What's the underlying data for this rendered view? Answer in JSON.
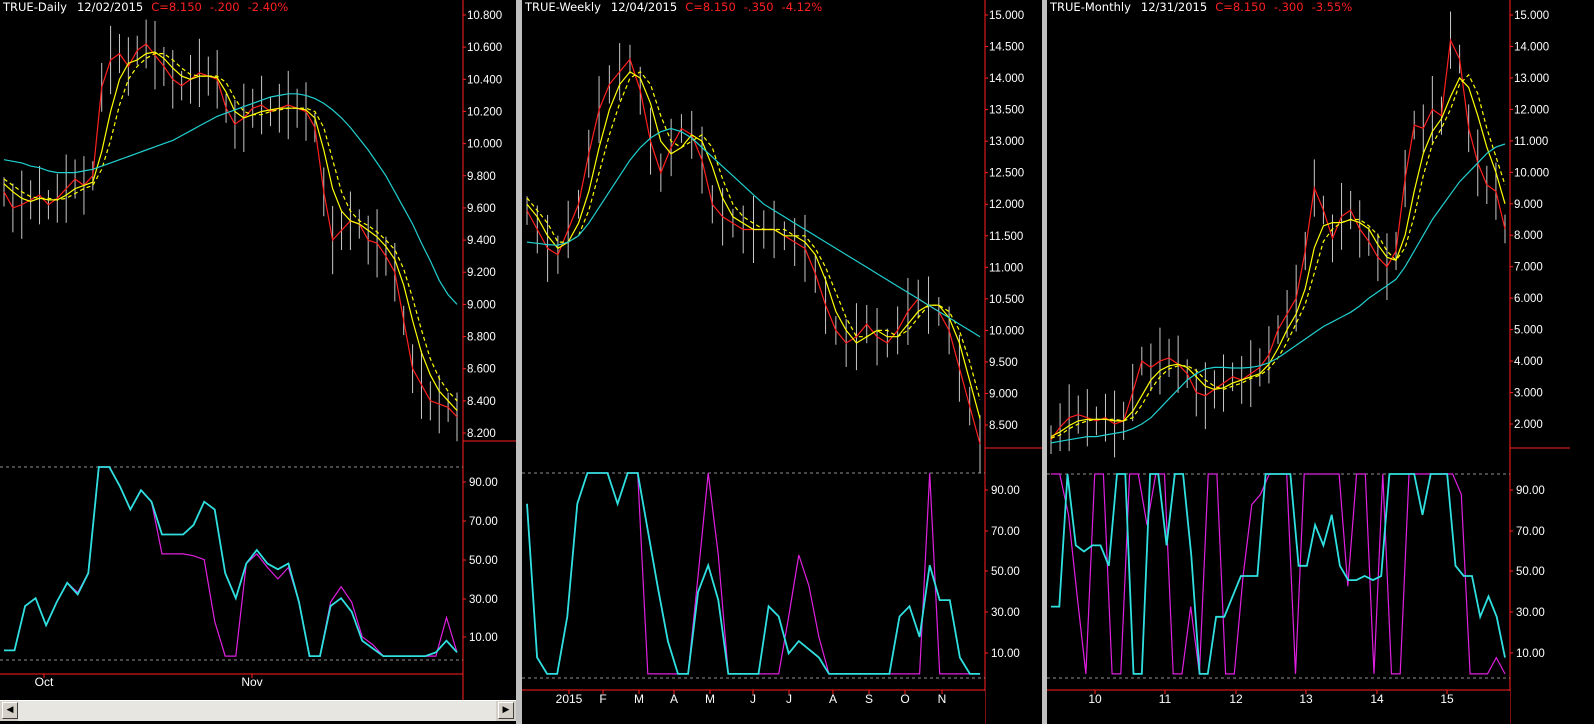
{
  "panels": [
    {
      "id": "daily",
      "symbol": "TRUE-Daily",
      "date": "12/02/2015",
      "close": "C=8.150",
      "change": "-.200",
      "pct": "-2.40%",
      "price_ticks": [
        "10.800",
        "10.600",
        "10.400",
        "10.200",
        "10.000",
        "9.800",
        "9.600",
        "9.400",
        "9.200",
        "9.000",
        "8.800",
        "8.600",
        "8.400",
        "8.200"
      ],
      "osc_ticks": [
        "90.00",
        "70.00",
        "50.00",
        "30.00",
        "10.00"
      ],
      "x_labels": [
        "Oct",
        "Nov"
      ]
    },
    {
      "id": "weekly",
      "symbol": "TRUE-Weekly",
      "date": "12/04/2015",
      "close": "C=8.150",
      "change": "-.350",
      "pct": "-4.12%",
      "price_ticks": [
        "15.000",
        "14.500",
        "14.000",
        "13.500",
        "13.000",
        "12.500",
        "12.000",
        "11.500",
        "11.000",
        "10.500",
        "10.000",
        "9.500",
        "9.000",
        "8.500"
      ],
      "osc_ticks": [
        "90.00",
        "70.00",
        "50.00",
        "30.00",
        "10.00"
      ],
      "x_labels": [
        "2015",
        "F",
        "M",
        "A",
        "M",
        "J",
        "J",
        "A",
        "S",
        "O",
        "N"
      ]
    },
    {
      "id": "monthly",
      "symbol": "TRUE-Monthly",
      "date": "12/31/2015",
      "close": "C=8.150",
      "change": "-.300",
      "pct": "-3.55%",
      "price_ticks": [
        "15.000",
        "14.000",
        "13.000",
        "12.000",
        "11.000",
        "10.000",
        "9.000",
        "8.000",
        "7.000",
        "6.000",
        "5.000",
        "4.000",
        "3.000",
        "2.000"
      ],
      "osc_ticks": [
        "90.00",
        "70.00",
        "50.00",
        "30.00",
        "10.00"
      ],
      "x_labels": [
        "10",
        "11",
        "12",
        "13",
        "14",
        "15"
      ]
    }
  ],
  "chart_data": [
    {
      "type": "line",
      "title": "TRUE-Daily",
      "price_ylim": [
        8.1,
        10.9
      ],
      "osc_ylim": [
        0,
        100
      ],
      "series": [
        {
          "name": "",
          "color": "#ff2020",
          "values": [
            9.7,
            9.6,
            9.62,
            9.65,
            9.68,
            9.62,
            9.66,
            9.72,
            9.78,
            9.74,
            9.8,
            10.35,
            10.52,
            10.56,
            10.48,
            10.58,
            10.62,
            10.55,
            10.48,
            10.4,
            10.36,
            10.4,
            10.44,
            10.42,
            10.4,
            10.22,
            10.12,
            10.16,
            10.22,
            10.24,
            10.2,
            10.22,
            10.24,
            10.22,
            10.2,
            10.1,
            9.7,
            9.4,
            9.46,
            9.52,
            9.5,
            9.4,
            9.38,
            9.3,
            9.2,
            8.9,
            8.6,
            8.5,
            8.4,
            8.38,
            8.36,
            8.3
          ]
        },
        {
          "name": "",
          "color": "#ffff00",
          "values": [
            9.75,
            9.7,
            9.66,
            9.64,
            9.66,
            9.65,
            9.65,
            9.68,
            9.72,
            9.74,
            9.76,
            9.95,
            10.2,
            10.4,
            10.5,
            10.52,
            10.56,
            10.57,
            10.53,
            10.47,
            10.42,
            10.4,
            10.42,
            10.42,
            10.41,
            10.32,
            10.2,
            10.16,
            10.18,
            10.2,
            10.21,
            10.22,
            10.22,
            10.22,
            10.21,
            10.16,
            9.96,
            9.72,
            9.58,
            9.52,
            9.5,
            9.46,
            9.42,
            9.36,
            9.28,
            9.12,
            8.9,
            8.7,
            8.56,
            8.46,
            8.4,
            8.34
          ]
        },
        {
          "name": "",
          "color": "#ffff00",
          "dashed": true,
          "values": [
            9.78,
            9.74,
            9.7,
            9.67,
            9.66,
            9.66,
            9.65,
            9.66,
            9.69,
            9.72,
            9.74,
            9.84,
            10.02,
            10.24,
            10.4,
            10.48,
            10.53,
            10.56,
            10.56,
            10.52,
            10.47,
            10.43,
            10.42,
            10.42,
            10.42,
            10.38,
            10.28,
            10.2,
            10.18,
            10.18,
            10.2,
            10.21,
            10.22,
            10.22,
            10.22,
            10.2,
            10.1,
            9.9,
            9.7,
            9.58,
            9.52,
            9.49,
            9.45,
            9.4,
            9.34,
            9.22,
            9.04,
            8.84,
            8.66,
            8.54,
            8.46,
            8.4
          ]
        },
        {
          "name": "",
          "color": "#20d0d0",
          "values": [
            9.9,
            9.89,
            9.88,
            9.86,
            9.85,
            9.83,
            9.82,
            9.82,
            9.82,
            9.83,
            9.84,
            9.86,
            9.88,
            9.9,
            9.92,
            9.94,
            9.96,
            9.98,
            10.0,
            10.02,
            10.05,
            10.08,
            10.11,
            10.14,
            10.17,
            10.19,
            10.21,
            10.23,
            10.25,
            10.27,
            10.29,
            10.3,
            10.31,
            10.31,
            10.3,
            10.28,
            10.25,
            10.21,
            10.16,
            10.1,
            10.03,
            9.96,
            9.88,
            9.8,
            9.7,
            9.6,
            9.5,
            9.38,
            9.27,
            9.15,
            9.06,
            9.0
          ]
        }
      ],
      "oscillator": [
        {
          "name": "",
          "color": "#e020e0",
          "values": [
            5,
            5,
            28,
            32,
            18,
            30,
            40,
            35,
            45,
            100,
            100,
            90,
            78,
            88,
            82,
            55,
            55,
            55,
            54,
            52,
            20,
            2,
            2,
            50,
            55,
            48,
            42,
            48,
            30,
            2,
            2,
            30,
            38,
            30,
            12,
            8,
            2,
            2,
            2,
            2,
            2,
            2,
            22,
            4
          ]
        },
        {
          "name": "",
          "color": "#30e0e0",
          "values": [
            5,
            5,
            28,
            32,
            18,
            30,
            40,
            34,
            45,
            100,
            100,
            90,
            78,
            88,
            82,
            65,
            65,
            65,
            70,
            82,
            78,
            45,
            32,
            50,
            57,
            50,
            47,
            50,
            30,
            2,
            2,
            28,
            32,
            25,
            10,
            6,
            2,
            2,
            2,
            2,
            2,
            4,
            10,
            4
          ]
        }
      ]
    },
    {
      "type": "line",
      "title": "TRUE-Weekly",
      "price_ylim": [
        8.0,
        15.2
      ],
      "osc_ylim": [
        0,
        100
      ],
      "series": [
        {
          "name": "",
          "color": "#ff2020",
          "values": [
            11.9,
            11.6,
            11.3,
            11.2,
            11.6,
            12.0,
            12.8,
            13.5,
            13.9,
            14.1,
            14.3,
            13.8,
            13.0,
            12.5,
            12.9,
            13.2,
            13.1,
            12.7,
            12.0,
            11.8,
            11.7,
            11.6,
            11.6,
            11.6,
            11.6,
            11.5,
            11.4,
            11.3,
            10.9,
            10.4,
            10.0,
            9.8,
            9.9,
            10.1,
            9.9,
            9.8,
            10.0,
            10.3,
            10.5,
            10.4,
            10.3,
            10.0,
            9.4,
            8.8,
            8.2
          ]
        },
        {
          "name": "",
          "color": "#ffff00",
          "values": [
            12.0,
            11.8,
            11.5,
            11.3,
            11.4,
            11.7,
            12.2,
            12.9,
            13.5,
            13.9,
            14.1,
            14.0,
            13.6,
            13.0,
            12.8,
            12.9,
            13.1,
            13.0,
            12.6,
            12.1,
            11.8,
            11.7,
            11.6,
            11.6,
            11.6,
            11.5,
            11.5,
            11.4,
            11.2,
            10.8,
            10.3,
            10.0,
            9.8,
            9.9,
            10.0,
            9.9,
            9.9,
            10.1,
            10.3,
            10.4,
            10.4,
            10.2,
            9.8,
            9.2,
            8.6
          ]
        },
        {
          "name": "",
          "color": "#ffff00",
          "dashed": true,
          "values": [
            12.1,
            11.9,
            11.7,
            11.4,
            11.4,
            11.5,
            11.9,
            12.5,
            13.1,
            13.6,
            14.0,
            14.1,
            13.9,
            13.4,
            13.0,
            12.9,
            13.0,
            13.1,
            12.9,
            12.4,
            12.0,
            11.8,
            11.7,
            11.6,
            11.6,
            11.6,
            11.5,
            11.5,
            11.3,
            11.0,
            10.6,
            10.2,
            9.9,
            9.9,
            10.0,
            10.0,
            9.9,
            10.0,
            10.2,
            10.4,
            10.4,
            10.3,
            10.0,
            9.5,
            8.9
          ]
        },
        {
          "name": "",
          "color": "#20d0d0",
          "values": [
            11.4,
            11.38,
            11.36,
            11.35,
            11.4,
            11.5,
            11.7,
            11.95,
            12.2,
            12.45,
            12.7,
            12.9,
            13.05,
            13.15,
            13.2,
            13.15,
            13.05,
            12.9,
            12.75,
            12.6,
            12.45,
            12.3,
            12.15,
            12.0,
            11.9,
            11.8,
            11.7,
            11.6,
            11.5,
            11.4,
            11.3,
            11.2,
            11.1,
            11.0,
            10.9,
            10.8,
            10.7,
            10.6,
            10.5,
            10.4,
            10.3,
            10.2,
            10.1,
            10.0,
            9.9
          ]
        }
      ],
      "oscillator": [
        {
          "name": "",
          "color": "#e020e0",
          "values": [
            85,
            10,
            2,
            2,
            30,
            85,
            100,
            100,
            100,
            85,
            100,
            100,
            2,
            2,
            2,
            2,
            2,
            50,
            100,
            60,
            2,
            2,
            2,
            2,
            2,
            2,
            30,
            60,
            45,
            20,
            2,
            2,
            2,
            2,
            2,
            2,
            2,
            2,
            2,
            2,
            100,
            2,
            2,
            2,
            2,
            2
          ]
        },
        {
          "name": "",
          "color": "#30e0e0",
          "values": [
            85,
            10,
            2,
            2,
            30,
            85,
            100,
            100,
            100,
            85,
            100,
            100,
            72,
            44,
            18,
            2,
            2,
            42,
            55,
            38,
            2,
            2,
            2,
            2,
            35,
            30,
            12,
            18,
            14,
            10,
            2,
            2,
            2,
            2,
            2,
            2,
            2,
            30,
            35,
            20,
            55,
            38,
            38,
            10,
            2,
            2
          ]
        }
      ]
    },
    {
      "type": "line",
      "title": "TRUE-Monthly",
      "price_ylim": [
        1.0,
        15.5
      ],
      "osc_ylim": [
        0,
        100
      ],
      "series": [
        {
          "name": "",
          "color": "#ff2020",
          "values": [
            1.5,
            1.9,
            2.2,
            2.3,
            2.2,
            2.1,
            2.2,
            2.0,
            2.1,
            3.0,
            4.0,
            3.8,
            4.0,
            4.1,
            3.9,
            3.6,
            3.0,
            2.9,
            3.1,
            3.3,
            3.5,
            3.4,
            3.6,
            3.8,
            4.2,
            5.0,
            5.5,
            6.0,
            7.5,
            9.5,
            8.8,
            7.9,
            8.6,
            8.8,
            8.2,
            7.8,
            7.3,
            7.0,
            7.5,
            9.8,
            11.5,
            11.4,
            12.0,
            11.8,
            14.2,
            13.6,
            11.4,
            10.3,
            9.6,
            9.4,
            8.2
          ]
        },
        {
          "name": "",
          "color": "#ffff00",
          "values": [
            1.6,
            1.75,
            1.95,
            2.1,
            2.15,
            2.15,
            2.15,
            2.1,
            2.1,
            2.4,
            2.9,
            3.4,
            3.7,
            3.85,
            3.9,
            3.8,
            3.5,
            3.2,
            3.1,
            3.15,
            3.3,
            3.4,
            3.5,
            3.6,
            3.9,
            4.4,
            5.0,
            5.5,
            6.3,
            7.6,
            8.3,
            8.4,
            8.4,
            8.5,
            8.4,
            8.2,
            7.7,
            7.3,
            7.2,
            8.0,
            9.4,
            10.6,
            11.3,
            11.7,
            12.4,
            13.0,
            12.7,
            11.8,
            10.8,
            10.0,
            9.0
          ]
        },
        {
          "name": "",
          "color": "#ffff00",
          "dashed": true,
          "values": [
            1.55,
            1.65,
            1.85,
            2.0,
            2.1,
            2.15,
            2.15,
            2.15,
            2.1,
            2.2,
            2.6,
            3.1,
            3.5,
            3.75,
            3.85,
            3.85,
            3.7,
            3.4,
            3.2,
            3.1,
            3.2,
            3.3,
            3.45,
            3.55,
            3.75,
            4.1,
            4.6,
            5.2,
            5.8,
            6.8,
            7.8,
            8.2,
            8.4,
            8.5,
            8.5,
            8.3,
            8.0,
            7.5,
            7.2,
            7.6,
            8.6,
            9.9,
            10.9,
            11.4,
            12.0,
            12.8,
            13.1,
            12.5,
            11.4,
            10.5,
            9.6
          ]
        },
        {
          "name": "",
          "color": "#20d0d0",
          "values": [
            1.4,
            1.45,
            1.5,
            1.55,
            1.6,
            1.6,
            1.65,
            1.7,
            1.75,
            1.85,
            2.0,
            2.2,
            2.5,
            2.8,
            3.1,
            3.4,
            3.6,
            3.75,
            3.8,
            3.8,
            3.78,
            3.78,
            3.8,
            3.85,
            3.95,
            4.1,
            4.3,
            4.5,
            4.7,
            4.9,
            5.1,
            5.25,
            5.4,
            5.55,
            5.75,
            6.0,
            6.2,
            6.4,
            6.6,
            7.0,
            7.5,
            8.0,
            8.5,
            8.9,
            9.3,
            9.7,
            10.0,
            10.3,
            10.6,
            10.8,
            10.9
          ]
        }
      ],
      "oscillator": [
        {
          "name": "",
          "color": "#e020e0",
          "values": [
            100,
            100,
            80,
            40,
            2,
            100,
            100,
            2,
            2,
            100,
            100,
            75,
            100,
            100,
            2,
            2,
            35,
            2,
            100,
            100,
            2,
            2,
            50,
            85,
            90,
            100,
            100,
            100,
            2,
            100,
            100,
            100,
            100,
            100,
            45,
            100,
            100,
            2,
            100,
            2,
            2,
            100,
            100,
            100,
            100,
            100,
            100,
            90,
            2,
            2,
            2,
            10,
            2
          ]
        },
        {
          "name": "",
          "color": "#30e0e0",
          "values": [
            35,
            35,
            100,
            65,
            62,
            65,
            65,
            55,
            100,
            100,
            2,
            2,
            100,
            100,
            65,
            100,
            100,
            60,
            2,
            2,
            30,
            30,
            40,
            50,
            50,
            50,
            100,
            100,
            100,
            100,
            55,
            55,
            75,
            65,
            80,
            55,
            48,
            48,
            50,
            48,
            50,
            100,
            100,
            100,
            100,
            80,
            100,
            100,
            100,
            55,
            50,
            50,
            30,
            40,
            30,
            10
          ]
        }
      ]
    }
  ]
}
